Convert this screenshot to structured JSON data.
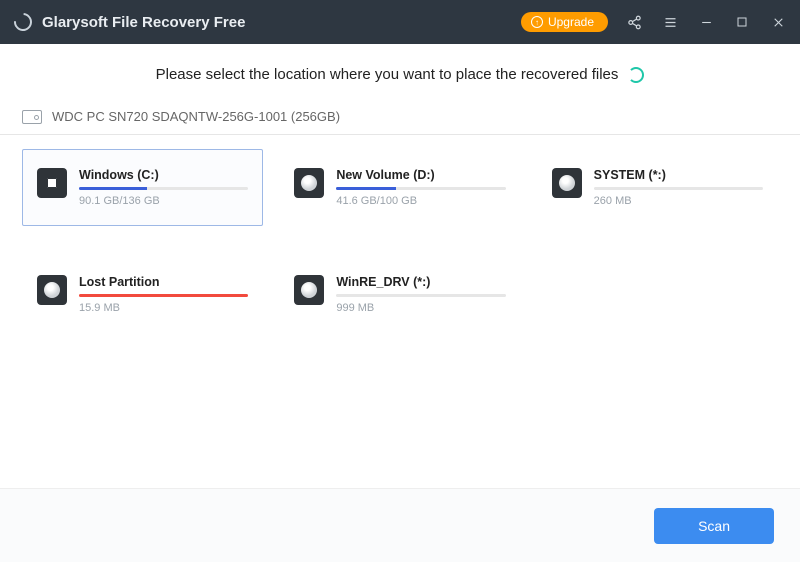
{
  "titlebar": {
    "app_name": "Glarysoft File Recovery Free",
    "upgrade_label": "Upgrade"
  },
  "instruction_text": "Please select the location where you want to place the recovered files",
  "disk": {
    "label": "WDC PC SN720 SDAQNTW-256G-1001 (256GB)"
  },
  "drives": [
    {
      "name": "Windows (C:)",
      "size": "90.1 GB/136 GB",
      "fill_pct": 40,
      "fill_class": "blue",
      "icon": "win",
      "selected": true
    },
    {
      "name": "New Volume (D:)",
      "size": "41.6 GB/100 GB",
      "fill_pct": 35,
      "fill_class": "blue",
      "icon": "disc",
      "selected": false
    },
    {
      "name": "SYSTEM (*:)",
      "size": "260 MB",
      "fill_pct": 0,
      "fill_class": "none",
      "icon": "disc",
      "selected": false
    },
    {
      "name": "Lost Partition",
      "size": "15.9 MB",
      "fill_pct": 100,
      "fill_class": "red",
      "icon": "disc",
      "selected": false
    },
    {
      "name": "WinRE_DRV (*:)",
      "size": "999 MB",
      "fill_pct": 0,
      "fill_class": "none",
      "icon": "disc",
      "selected": false
    }
  ],
  "footer": {
    "scan_label": "Scan"
  }
}
